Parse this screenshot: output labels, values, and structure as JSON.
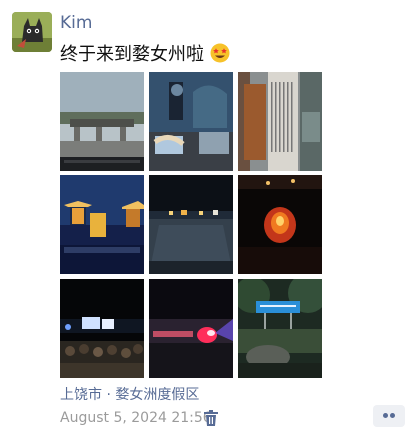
{
  "post": {
    "author": "Kim",
    "text": "终于来到婺女州啦",
    "emoji": "star-struck-face-icon",
    "location": "上饶市 · 婺女洲度假区",
    "timestamp": "August 5, 2024 21:56"
  },
  "photos": [
    {
      "name": "photo-toll-gate"
    },
    {
      "name": "photo-exhibition-hall"
    },
    {
      "name": "photo-stone-tablet"
    },
    {
      "name": "photo-night-pavilion"
    },
    {
      "name": "photo-night-plaza"
    },
    {
      "name": "photo-fire-performance"
    },
    {
      "name": "photo-night-show-crowd"
    },
    {
      "name": "photo-stage-light"
    },
    {
      "name": "photo-scenic-sign"
    }
  ],
  "colors": {
    "link": "#576b95",
    "text": "#111111",
    "muted": "#9b9b9b",
    "button_bg": "#eef0f4"
  }
}
